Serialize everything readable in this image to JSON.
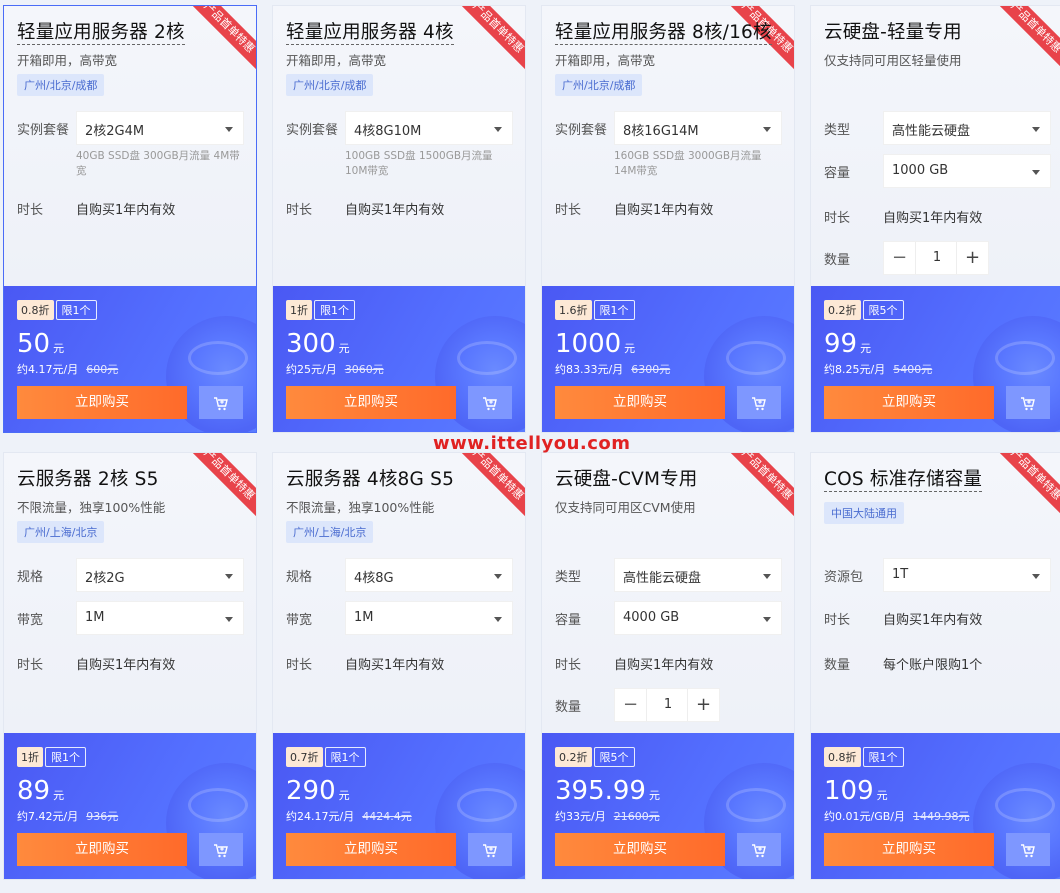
{
  "watermark": "www.ittellyou.com",
  "cards": [
    {
      "title": "轻量应用服务器 2核",
      "subtitle": "开箱即用，高带宽",
      "tag": "广州/北京/成都",
      "ribbon": "产品首单特惠",
      "rows": [
        {
          "type": "select",
          "label": "实例套餐",
          "value": "2核2G4M",
          "note": "40GB SSD盘 300GB月流量 4M带宽"
        },
        {
          "type": "text",
          "label": "时长",
          "value": "自购买1年内有效"
        }
      ],
      "discount": "0.8折",
      "limit": "限1个",
      "price": "50",
      "unit": "元",
      "monthly": "约4.17元/月",
      "original": "600元",
      "buy_label": "立即购买"
    },
    {
      "title": "轻量应用服务器 4核",
      "subtitle": "开箱即用，高带宽",
      "tag": "广州/北京/成都",
      "ribbon": "产品首单特惠",
      "rows": [
        {
          "type": "select",
          "label": "实例套餐",
          "value": "4核8G10M",
          "note": "100GB SSD盘 1500GB月流量 10M带宽"
        },
        {
          "type": "text",
          "label": "时长",
          "value": "自购买1年内有效"
        }
      ],
      "discount": "1折",
      "limit": "限1个",
      "price": "300",
      "unit": "元",
      "monthly": "约25元/月",
      "original": "3060元",
      "buy_label": "立即购买"
    },
    {
      "title": "轻量应用服务器 8核/16核",
      "subtitle": "开箱即用，高带宽",
      "tag": "广州/北京/成都",
      "ribbon": "产品首单特惠",
      "rows": [
        {
          "type": "select",
          "label": "实例套餐",
          "value": "8核16G14M",
          "note": "160GB SSD盘 3000GB月流量 14M带宽"
        },
        {
          "type": "text",
          "label": "时长",
          "value": "自购买1年内有效"
        }
      ],
      "discount": "1.6折",
      "limit": "限1个",
      "price": "1000",
      "unit": "元",
      "monthly": "约83.33元/月",
      "original": "6300元",
      "buy_label": "立即购买"
    },
    {
      "title": "云硬盘-轻量专用",
      "subtitle": "仅支持同可用区轻量使用",
      "tag": "",
      "ribbon": "产品首单特惠",
      "rows": [
        {
          "type": "select",
          "label": "类型",
          "value": "高性能云硬盘"
        },
        {
          "type": "select",
          "label": "容量",
          "value": "1000 GB"
        },
        {
          "type": "text",
          "label": "时长",
          "value": "自购买1年内有效"
        },
        {
          "type": "stepper",
          "label": "数量",
          "value": "1"
        }
      ],
      "discount": "0.2折",
      "limit": "限5个",
      "price": "99",
      "unit": "元",
      "monthly": "约8.25元/月",
      "original": "5400元",
      "buy_label": "立即购买"
    },
    {
      "title": "云服务器 2核 S5",
      "subtitle": "不限流量，独享100%性能",
      "tag": "广州/上海/北京",
      "ribbon": "产品首单特惠",
      "rows": [
        {
          "type": "select",
          "label": "规格",
          "value": "2核2G"
        },
        {
          "type": "select",
          "label": "带宽",
          "value": "1M"
        },
        {
          "type": "text",
          "label": "时长",
          "value": "自购买1年内有效"
        }
      ],
      "discount": "1折",
      "limit": "限1个",
      "price": "89",
      "unit": "元",
      "monthly": "约7.42元/月",
      "original": "936元",
      "buy_label": "立即购买"
    },
    {
      "title": "云服务器 4核8G S5",
      "subtitle": "不限流量，独享100%性能",
      "tag": "广州/上海/北京",
      "ribbon": "产品首单特惠",
      "rows": [
        {
          "type": "select",
          "label": "规格",
          "value": "4核8G"
        },
        {
          "type": "select",
          "label": "带宽",
          "value": "1M"
        },
        {
          "type": "text",
          "label": "时长",
          "value": "自购买1年内有效"
        }
      ],
      "discount": "0.7折",
      "limit": "限1个",
      "price": "290",
      "unit": "元",
      "monthly": "约24.17元/月",
      "original": "4424.4元",
      "buy_label": "立即购买"
    },
    {
      "title": "云硬盘-CVM专用",
      "subtitle": "仅支持同可用区CVM使用",
      "tag": "",
      "ribbon": "产品首单特惠",
      "rows": [
        {
          "type": "select",
          "label": "类型",
          "value": "高性能云硬盘"
        },
        {
          "type": "select",
          "label": "容量",
          "value": "4000 GB"
        },
        {
          "type": "text",
          "label": "时长",
          "value": "自购买1年内有效"
        },
        {
          "type": "stepper",
          "label": "数量",
          "value": "1"
        }
      ],
      "discount": "0.2折",
      "limit": "限5个",
      "price": "395.99",
      "unit": "元",
      "monthly": "约33元/月",
      "original": "21600元",
      "buy_label": "立即购买"
    },
    {
      "title": "COS 标准存储容量",
      "subtitle": "",
      "tag": "中国大陆通用",
      "ribbon": "产品首单特惠",
      "rows": [
        {
          "type": "select",
          "label": "资源包",
          "value": "1T"
        },
        {
          "type": "text",
          "label": "时长",
          "value": "自购买1年内有效"
        },
        {
          "type": "text",
          "label": "数量",
          "value": "每个账户限购1个"
        }
      ],
      "discount": "0.8折",
      "limit": "限1个",
      "price": "109",
      "unit": "元",
      "monthly": "约0.01元/GB/月",
      "original": "1449.98元",
      "buy_label": "立即购买"
    }
  ]
}
